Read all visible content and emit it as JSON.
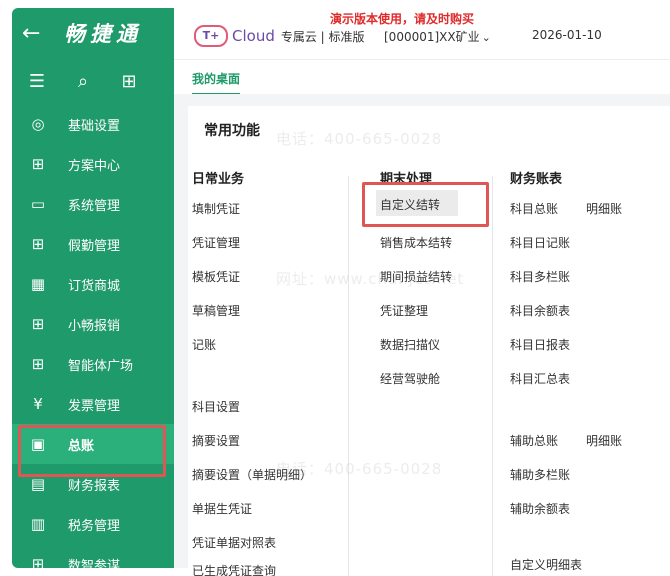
{
  "sidebar": {
    "back_icon": "←",
    "brand": "畅捷通",
    "items": [
      {
        "icon": "gear-icon",
        "label": "基础设置"
      },
      {
        "icon": "grid-plus-icon",
        "label": "方案中心"
      },
      {
        "icon": "monitor-code-icon",
        "label": "系统管理"
      },
      {
        "icon": "grid-plus-icon",
        "label": "假勤管理"
      },
      {
        "icon": "store-icon",
        "label": "订货商城"
      },
      {
        "icon": "grid-plus-icon",
        "label": "小畅报销"
      },
      {
        "icon": "grid-plus-icon",
        "label": "智能体广场"
      },
      {
        "icon": "invoice-icon",
        "label": "发票管理"
      },
      {
        "icon": "ledger-icon",
        "label": "总账"
      },
      {
        "icon": "report-icon",
        "label": "财务报表"
      },
      {
        "icon": "tax-icon",
        "label": "税务管理"
      },
      {
        "icon": "grid-plus-icon",
        "label": "数智参谋"
      }
    ],
    "active_index": 8
  },
  "topbar": {
    "demo_notice": "演示版本使用，请及时购买",
    "logo_text": "Cloud",
    "tier": "专属云 | 标准版",
    "company": "[000001]XX矿业",
    "date": "2026-01-10"
  },
  "tabs": [
    {
      "label": "我的桌面"
    }
  ],
  "card": {
    "title": "常用功能",
    "col1": {
      "heading": "日常业务",
      "items": [
        "填制凭证",
        "凭证管理",
        "模板凭证",
        "草稿管理",
        "记账",
        "科目设置",
        "摘要设置",
        "摘要设置（单据明细）",
        "单据生凭证",
        "凭证单据对照表",
        "已生成凭证查询"
      ]
    },
    "col2": {
      "heading": "期末处理",
      "items": [
        "自定义结转",
        "销售成本结转",
        "期间损益结转",
        "凭证整理",
        "数据扫描仪",
        "经营驾驶舱"
      ]
    },
    "col3": {
      "heading": "财务账表",
      "items": [
        "科目总账",
        "明细账",
        "科目日记账",
        "科目多栏账",
        "科目余额表",
        "科目日报表",
        "科目汇总表",
        "辅助总账",
        "明细账",
        "辅助多栏账",
        "辅助余额表",
        "自定义明细表"
      ]
    }
  },
  "watermark": {
    "phone": "电话：400-665-0028",
    "site": "网址：www.chanjet.net"
  },
  "colors": {
    "sidebar": "#1f9a6a",
    "accent": "#1f9a6a",
    "highlight": "#e05656",
    "demo": "#e02b2b"
  }
}
